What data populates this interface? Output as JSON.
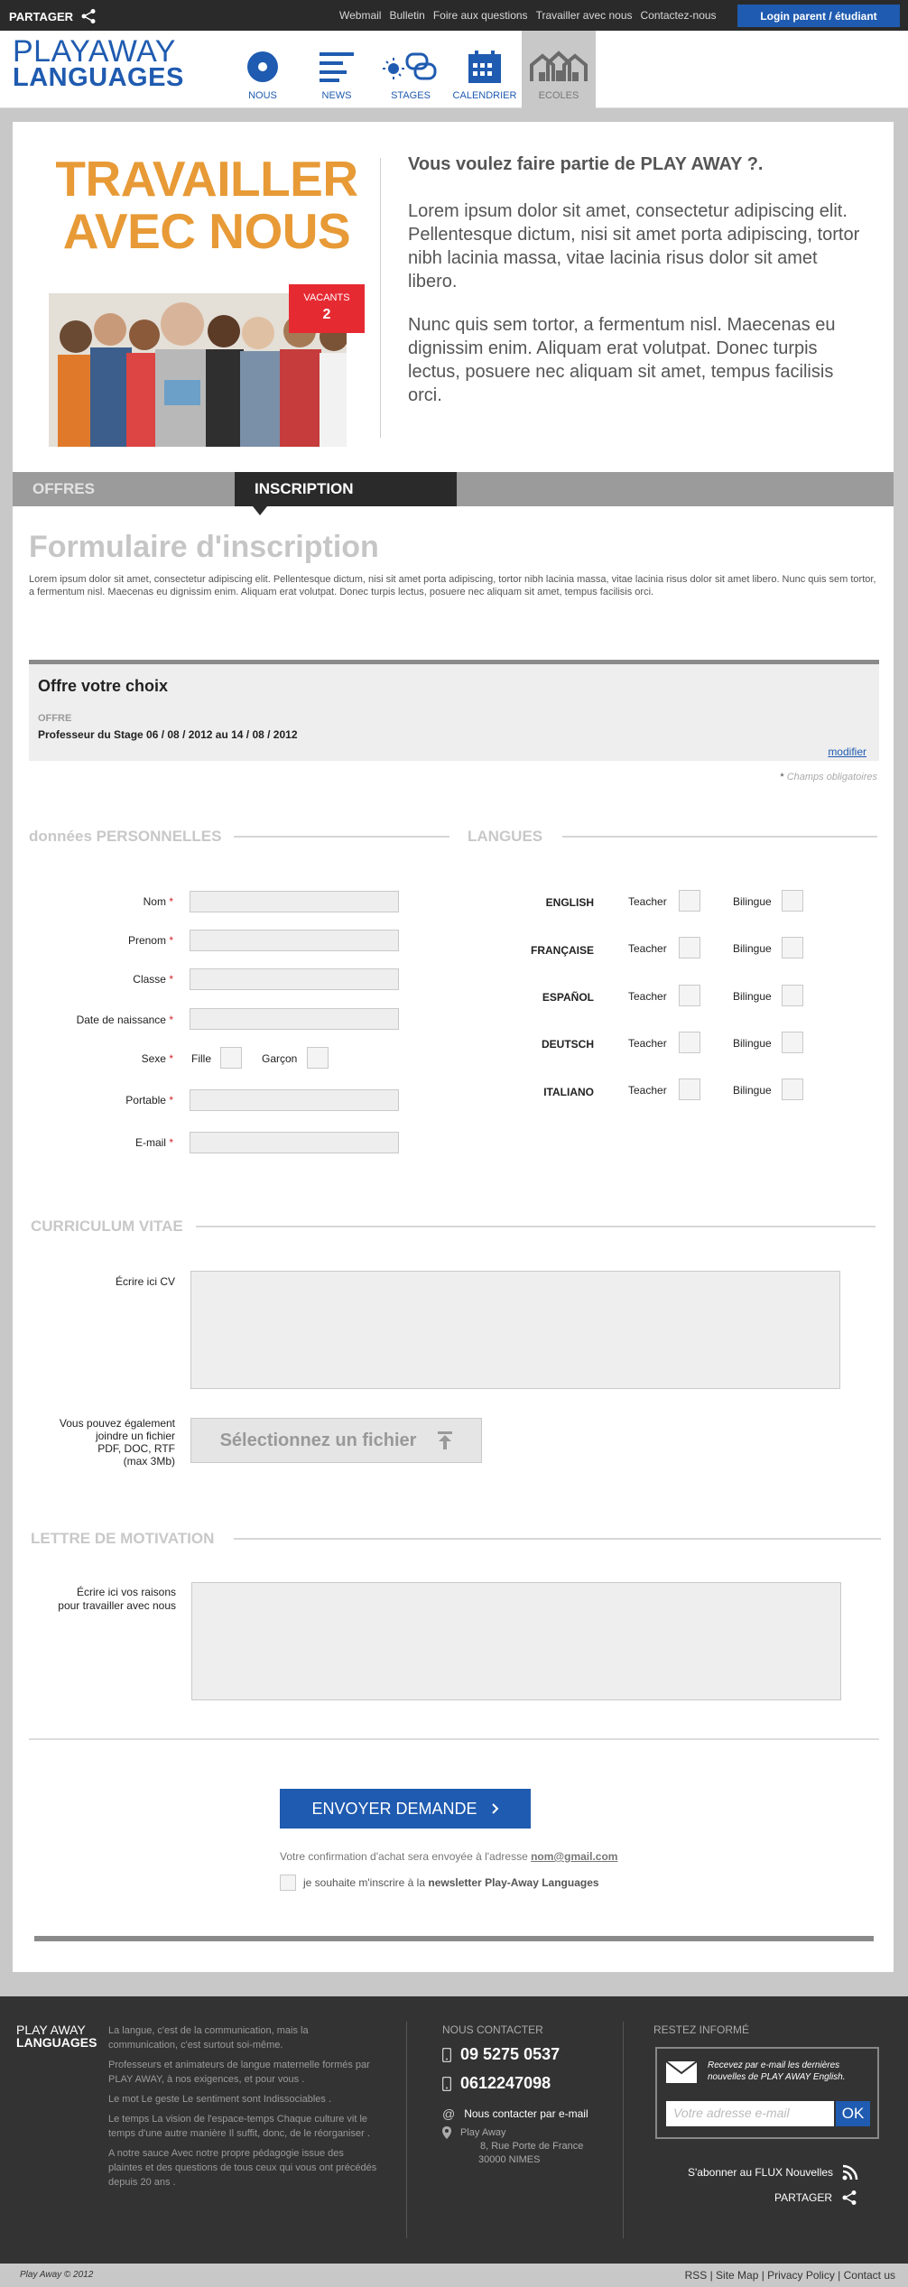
{
  "topbar": {
    "share": "PARTAGER",
    "links": [
      "Webmail",
      "Bulletin",
      "Foire aux questions",
      "Travailler avec nous",
      "Contactez-nous"
    ],
    "login": "Login parent / étudiant"
  },
  "header": {
    "logo_line1": "PLAYAWAY",
    "logo_line2": "LANGUAGES",
    "nav": [
      {
        "label": "NOUS",
        "icon": "circle-dot-icon"
      },
      {
        "label": "NEWS",
        "icon": "list-lines-icon"
      },
      {
        "label": "STAGES",
        "icon": "sun-chat-icon"
      },
      {
        "label": "CALENDRIER",
        "icon": "calendar-icon"
      },
      {
        "label": "ECOLES",
        "icon": "houses-icon"
      }
    ]
  },
  "hero": {
    "title_line1": "TRAVAILLER",
    "title_line2": "AVEC NOUS",
    "vacants_label": "VACANTS",
    "vacants_count": "2",
    "heading": "Vous voulez faire partie de PLAY AWAY ?.",
    "p1": "Lorem ipsum dolor sit amet, consectetur adipiscing elit. Pellentesque dictum, nisi sit amet porta adipiscing, tortor nibh lacinia massa, vitae lacinia risus dolor sit amet libero.",
    "p2": "Nunc quis sem tortor, a fermentum nisl. Maecenas eu dignissim enim. Aliquam erat volutpat. Donec turpis lectus, posuere nec aliquam sit amet, tempus facilisis orci."
  },
  "tabs": {
    "offres": "OFFRES",
    "inscription": "INSCRIPTION"
  },
  "form": {
    "title": "Formulaire d'inscription",
    "intro": "Lorem ipsum dolor sit amet, consectetur adipiscing elit. Pellentesque dictum, nisi sit amet porta adipiscing, tortor nibh lacinia massa, vitae lacinia risus dolor sit amet libero. Nunc quis sem tortor, a fermentum nisl. Maecenas eu dignissim enim. Aliquam erat volutpat. Donec turpis lectus, posuere nec aliquam sit amet, tempus facilisis orci.",
    "offre_title": "Offre votre choix",
    "offre_label": "OFFRE",
    "offre_value": "Professeur du Stage 06 / 08 / 2012  au  14 / 08 / 2012",
    "modifier": "modifier",
    "required_note": "Champs obligatoires",
    "required_star": "*"
  },
  "personal": {
    "heading": "données PERSONNELLES",
    "fields": [
      "Nom",
      "Prenom",
      "Classe",
      "Date de naissance",
      "Sexe",
      "Portable",
      "E-mail"
    ],
    "sexe_options": [
      "Fille",
      "Garçon"
    ]
  },
  "langues": {
    "heading": "LANGUES",
    "languages": [
      "ENGLISH",
      "FRANÇAISE",
      "ESPAÑOL",
      "DEUTSCH",
      "ITALIANO"
    ],
    "teacher": "Teacher",
    "bilingue": "Bilingue"
  },
  "cv": {
    "heading": "CURRICULUM VITAE",
    "write_label": "Écrire ici CV",
    "attach_lines": [
      "Vous pouvez également",
      "joindre un fichier",
      "PDF, DOC, RTF",
      "(max 3Mb)"
    ],
    "file_button": "Sélectionnez un fichier"
  },
  "motivation": {
    "heading": "LETTRE DE MOTIVATION",
    "label_lines": [
      "Écrire ici vos raisons",
      "pour travailler avec nous"
    ]
  },
  "submit": {
    "button": "ENVOYER DEMANDE",
    "confirm_text": "Votre confirmation d'achat sera envoyée à l'adresse",
    "confirm_email": "nom@gmail.com",
    "newsletter_pre": "je souhaite  m'inscrire à la",
    "newsletter_bold": "newsletter Play-Away Languages"
  },
  "footer": {
    "logo_line1": "PLAY AWAY",
    "logo_line2": "LANGUAGES",
    "about": [
      "La langue, c'est de la communication, mais la communication, c'est surtout soi-même.",
      "Professeurs et animateurs de langue maternelle formés par PLAY AWAY, à nos exigences, et pour vous .",
      "Le mot Le geste Le sentiment sont Indissociables .",
      "Le temps La vision de l'espace-temps Chaque culture vit le temps d'une autre manière Il suffit, donc, de le réorganiser .",
      "A notre sauce Avec notre propre pédagogie issue des plaintes et des questions de tous ceux qui vous ont précédés depuis 20 ans ."
    ],
    "contact_heading": "NOUS CONTACTER",
    "phone1": "09 5275 0537",
    "phone2": "0612247098",
    "email_label": "Nous contacter par e-mail",
    "address": [
      "Play Away",
      "8, Rue Porte de France",
      "30000 NIMES"
    ],
    "informed_heading": "RESTEZ INFORMÉ",
    "nl_text": "Recevez par e-mail les dernières nouvelles de PLAY AWAY English.",
    "nl_placeholder": "Votre adresse e-mail",
    "nl_ok": "OK",
    "rss": "S'abonner au FLUX Nouvelles",
    "share": "PARTAGER"
  },
  "subfooter": {
    "copyright": "Play Away © 2012",
    "links": "RSS | Site Map | Privacy Policy | Contact us"
  },
  "colors": {
    "brand_blue": "#1f5bb0",
    "orange": "#e79a36",
    "red": "#e62a32",
    "dark": "#2a2a2a"
  }
}
